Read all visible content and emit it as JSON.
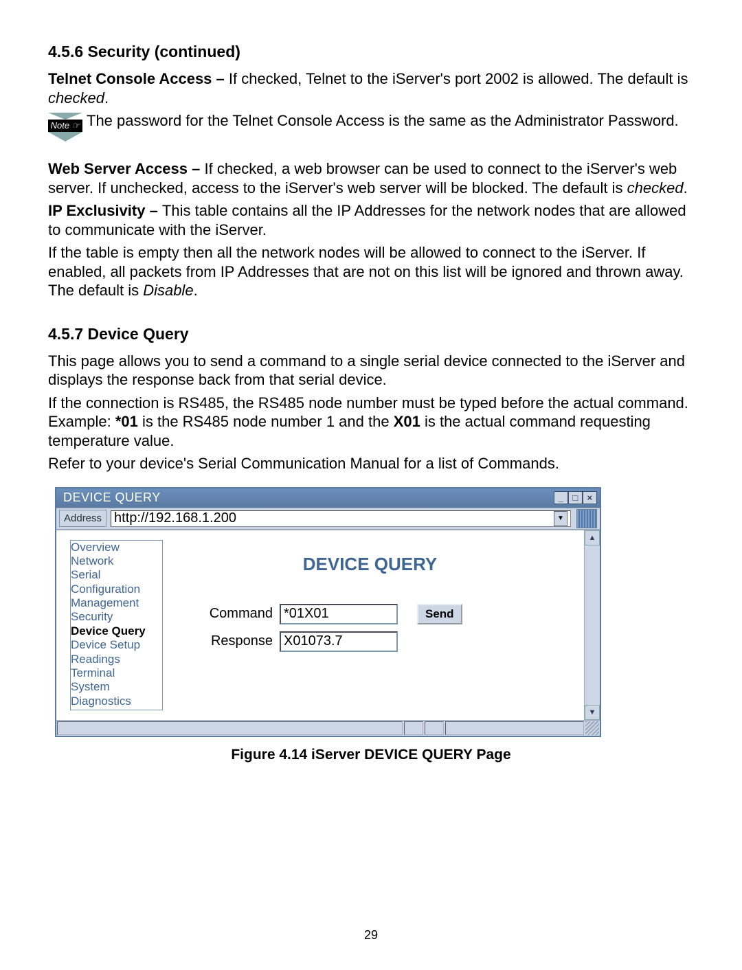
{
  "section456": {
    "heading": "4.5.6  Security (continued)"
  },
  "telnet": {
    "bold": "Telnet Console Access – ",
    "rest1": "If checked, Telnet to the iServer's port 2002 is allowed. The default is ",
    "ital": "checked",
    "rest2": "."
  },
  "note": {
    "icon_label": "Note ☞",
    "text": "The password for the Telnet Console Access is the same as the Administrator Password."
  },
  "web": {
    "bold": "Web Server Access – ",
    "rest1": "If checked, a web browser can be used to connect to the iServer's web server. If unchecked, access to the iServer's web server will be blocked. The default is ",
    "ital": "checked",
    "rest2": "."
  },
  "ipex": {
    "bold": "IP Exclusivity – ",
    "rest": "This table contains all the IP Addresses for the network nodes that are allowed to communicate with the iServer."
  },
  "ipex2": {
    "t1": "If the table is empty then all the network nodes will be allowed to connect to the iServer. If enabled, all packets from IP Addresses that are not on this list will be ignored and thrown away. The default is ",
    "ital": "Disable",
    "t2": "."
  },
  "section457": {
    "heading": "4.5.7  Device Query"
  },
  "dq_p1": "This page allows you to send a command to a single serial device connected to the iServer and displays the response back from that serial device.",
  "dq_p2a": "If the connection is RS485, the RS485 node number must be typed before the actual command. Example: ",
  "dq_p2b": "*01",
  "dq_p2c": " is the RS485 node number 1 and the ",
  "dq_p2d": "X01",
  "dq_p2e": " is the actual command requesting temperature value.",
  "dq_p3": "Refer to your device's Serial Communication Manual for a list of Commands.",
  "browser": {
    "title": "DEVICE QUERY",
    "addr_label": "Address",
    "addr_value": "http://192.168.1.200",
    "nav": [
      "Overview",
      "Network",
      "Serial",
      "Configuration",
      "Management",
      "Security",
      "Device Query",
      "Device Setup",
      "Readings",
      "Terminal",
      "System",
      "Diagnostics"
    ],
    "active_nav": "Device Query",
    "main_title": "DEVICE QUERY",
    "cmd_label": "Command",
    "cmd_value": "*01X01",
    "send": "Send",
    "resp_label": "Response",
    "resp_value": "X01073.7"
  },
  "fig_caption": "Figure 4.14  iServer DEVICE QUERY Page",
  "page_number": "29"
}
